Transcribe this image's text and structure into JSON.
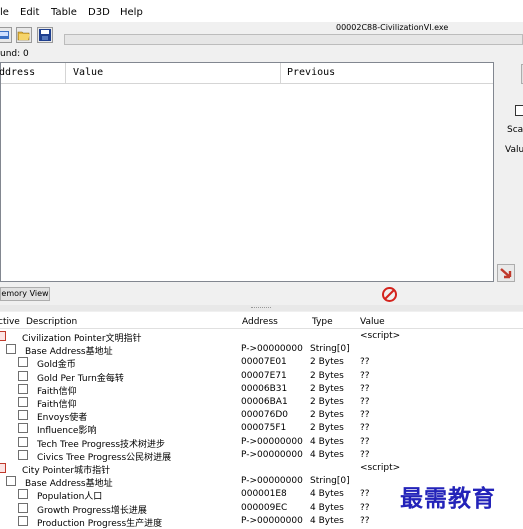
{
  "menu": [
    "le",
    "Edit",
    "Table",
    "D3D",
    "Help"
  ],
  "process_title": "00002C88-CivilizationVI.exe",
  "found_label": "und: 0",
  "results_columns": [
    "ddress",
    "Value",
    "Previous"
  ],
  "right_panel": {
    "scan_label": "Sca",
    "value_label": "Valu"
  },
  "memory_view_label": "emory View",
  "table_columns": [
    "ctive",
    "Description",
    "Address",
    "Type",
    "Value"
  ],
  "rows": [
    {
      "desc": "Civilization Pointer文明指针",
      "addr": "",
      "type": "",
      "value": "<script>",
      "indent": 1,
      "red": true
    },
    {
      "desc": "Base Address基地址",
      "addr": "P->00000000",
      "type": "String[0]",
      "value": "",
      "indent": 2,
      "red": false
    },
    {
      "desc": "Gold金币",
      "addr": "00007E01",
      "type": "2 Bytes",
      "value": "??",
      "indent": 3,
      "red": false
    },
    {
      "desc": "Gold Per Turn金每转",
      "addr": "00007E71",
      "type": "2 Bytes",
      "value": "??",
      "indent": 3,
      "red": false
    },
    {
      "desc": "Faith信仰",
      "addr": "00006B31",
      "type": "2 Bytes",
      "value": "??",
      "indent": 3,
      "red": false
    },
    {
      "desc": "Faith信仰",
      "addr": "00006BA1",
      "type": "2 Bytes",
      "value": "??",
      "indent": 3,
      "red": false
    },
    {
      "desc": "Envoys使者",
      "addr": "000076D0",
      "type": "2 Bytes",
      "value": "??",
      "indent": 3,
      "red": false
    },
    {
      "desc": "Influence影响",
      "addr": "000075F1",
      "type": "2 Bytes",
      "value": "??",
      "indent": 3,
      "red": false
    },
    {
      "desc": "Tech Tree Progress技术树进步",
      "addr": "P->00000000",
      "type": "4 Bytes",
      "value": "??",
      "indent": 3,
      "red": false
    },
    {
      "desc": "Civics Tree Progress公民树进展",
      "addr": "P->00000000",
      "type": "4 Bytes",
      "value": "??",
      "indent": 3,
      "red": false
    },
    {
      "desc": "City Pointer城市指针",
      "addr": "",
      "type": "",
      "value": "<script>",
      "indent": 1,
      "red": true
    },
    {
      "desc": "Base Address基地址",
      "addr": "P->00000000",
      "type": "String[0]",
      "value": "",
      "indent": 2,
      "red": false
    },
    {
      "desc": "Population人口",
      "addr": "000001E8",
      "type": "4 Bytes",
      "value": "??",
      "indent": 3,
      "red": false
    },
    {
      "desc": "Growth Progress增长进展",
      "addr": "000009EC",
      "type": "4 Bytes",
      "value": "??",
      "indent": 3,
      "red": false
    },
    {
      "desc": "Production Progress生产进度",
      "addr": "P->00000000",
      "type": "4 Bytes",
      "value": "??",
      "indent": 3,
      "red": false
    }
  ],
  "watermark": "最需教育"
}
